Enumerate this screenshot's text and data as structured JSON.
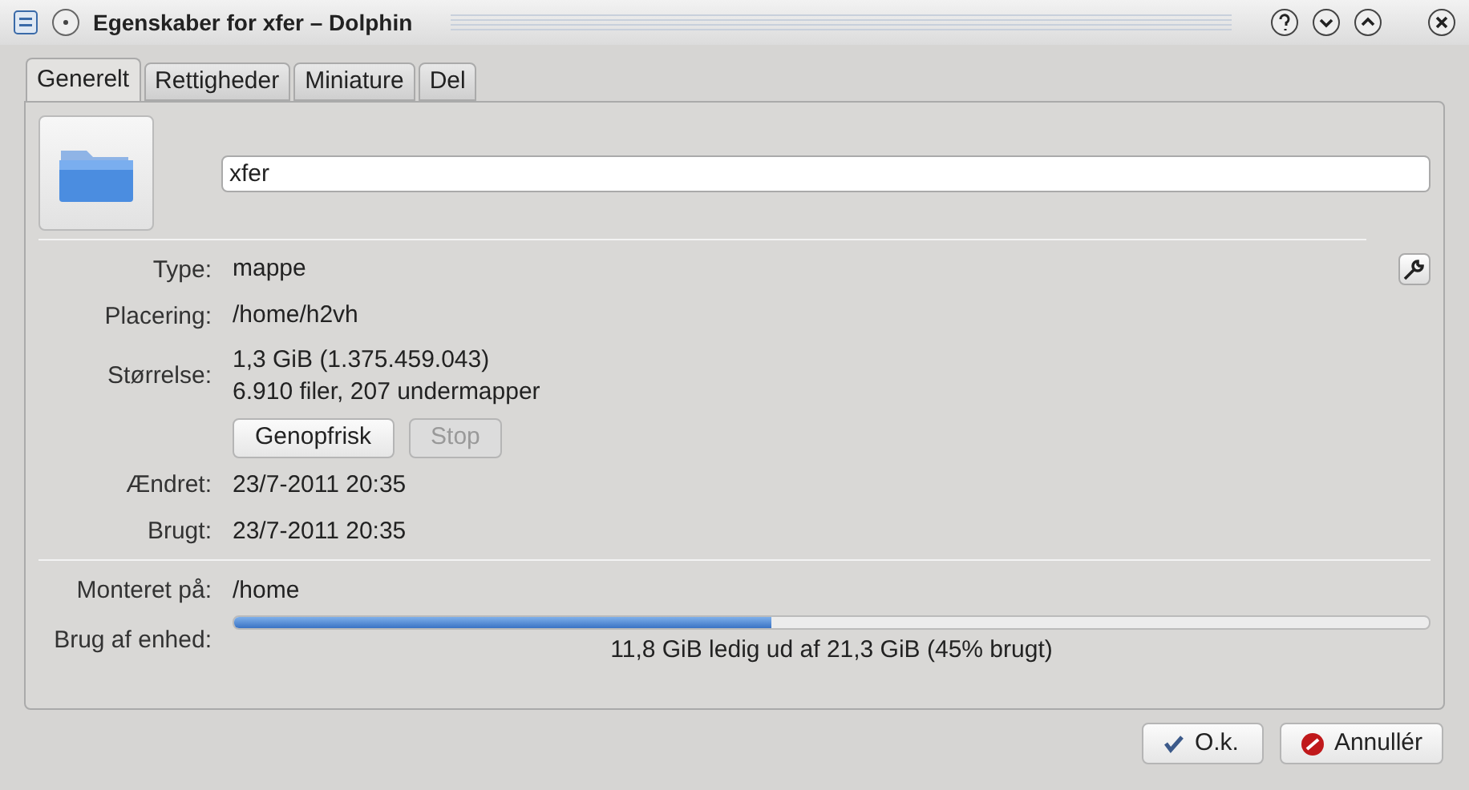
{
  "window": {
    "title": "Egenskaber for xfer – Dolphin"
  },
  "tabs": [
    {
      "label": "Generelt",
      "selected": true
    },
    {
      "label": "Rettigheder",
      "selected": false
    },
    {
      "label": "Miniature",
      "selected": false
    },
    {
      "label": "Del",
      "selected": false
    }
  ],
  "name_field": {
    "value": "xfer"
  },
  "info": [
    {
      "label": "Type:",
      "lines": [
        "mappe"
      ]
    },
    {
      "label": "Placering:",
      "lines": [
        "/home/h2vh"
      ]
    },
    {
      "label": "Størrelse:",
      "lines": [
        "1,3 GiB (1.375.459.043)",
        "6.910 filer, 207 undermapper"
      ]
    }
  ],
  "size_buttons": [
    {
      "label": "Genopfrisk",
      "disabled": false
    },
    {
      "label": "Stop",
      "disabled": true
    }
  ],
  "dates": [
    {
      "label": "Ændret:",
      "value": "23/7-2011 20:35"
    },
    {
      "label": "Brugt:",
      "value": "23/7-2011 20:35"
    }
  ],
  "mount": {
    "label": "Monteret på:",
    "value": "/home"
  },
  "usage": {
    "label": "Brug af enhed:",
    "level": 0.45,
    "text": "11,8 GiB ledig ud af 21,3 GiB (45% brugt)"
  },
  "buttons": [
    {
      "label": "O.k.",
      "kind": "ok"
    },
    {
      "label": "Annullér",
      "kind": "cancel"
    }
  ]
}
